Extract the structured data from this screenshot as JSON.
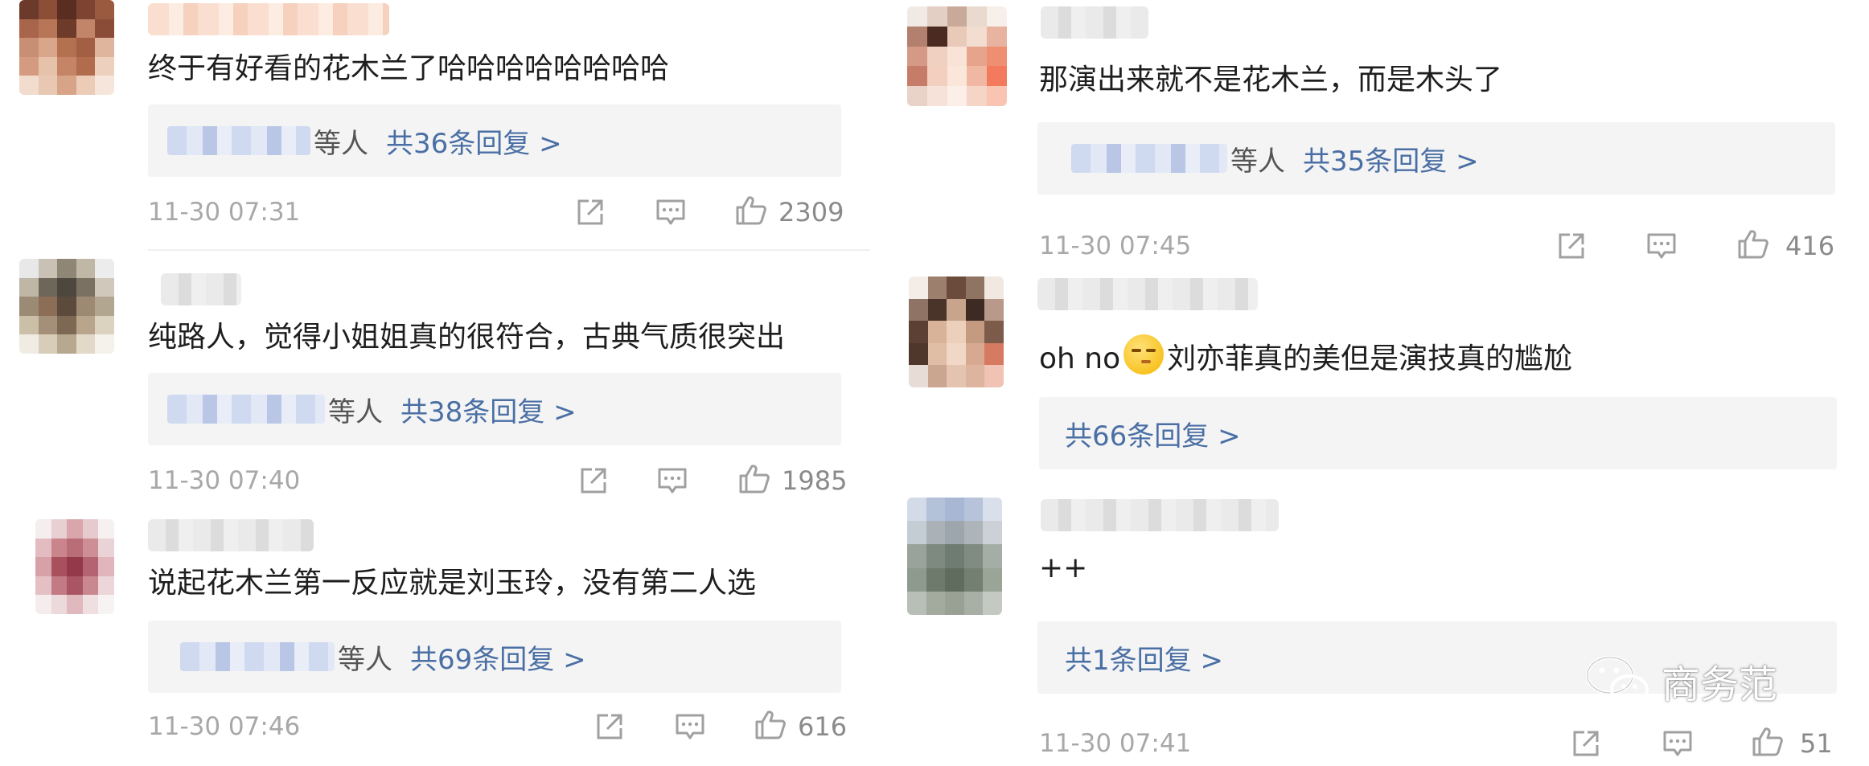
{
  "left_column": [
    {
      "text": "终于有好看的花木兰了哈哈哈哈哈哈哈哈",
      "reply_suffix": "等人",
      "reply_count": "共36条回复 >",
      "time": "11-30 07:31",
      "likes": "2309"
    },
    {
      "text": "纯路人，觉得小姐姐真的很符合，古典气质很突出",
      "reply_suffix": "等人",
      "reply_count": "共38条回复 >",
      "time": "11-30 07:40",
      "likes": "1985"
    },
    {
      "text": "说起花木兰第一反应就是刘玉玲，没有第二人选",
      "reply_suffix": "等人",
      "reply_count": "共69条回复 >",
      "time": "11-30 07:46",
      "likes": "616"
    }
  ],
  "right_column": [
    {
      "text": "那演出来就不是花木兰，而是木头了",
      "reply_suffix": "等人",
      "reply_count": "共35条回复 >",
      "time": "11-30 07:45",
      "likes": "416"
    },
    {
      "text_prefix": "oh no",
      "text_suffix": "刘亦菲真的美但是演技真的尴尬",
      "reply_count": "共66条回复 >"
    },
    {
      "text": "++",
      "reply_count": "共1条回复 >",
      "time": "11-30 07:41",
      "likes": "51"
    }
  ],
  "watermark": "商务范",
  "icons": [
    "share-icon",
    "comment-icon",
    "thumbs-up-icon",
    "wechat-logo-icon"
  ],
  "colors": {
    "reply_link": "#4a6fa5",
    "reply_bg": "#f4f4f4",
    "meta_gray": "#a8a8a8"
  }
}
